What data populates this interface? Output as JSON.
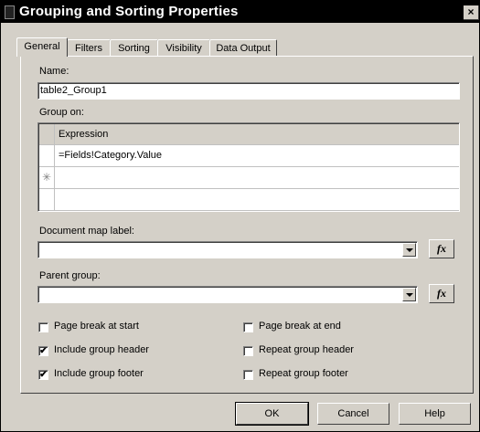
{
  "window": {
    "title": "Grouping and Sorting Properties",
    "close_glyph": "×"
  },
  "tabs": [
    {
      "label": "General"
    },
    {
      "label": "Filters"
    },
    {
      "label": "Sorting"
    },
    {
      "label": "Visibility"
    },
    {
      "label": "Data Output"
    }
  ],
  "general": {
    "name_label": "Name:",
    "name_value": "table2_Group1",
    "group_on_label": "Group on:",
    "grid_header": "Expression",
    "grid_rows": [
      "=Fields!Category.Value"
    ],
    "new_row_glyph": "✳",
    "doc_map_label": "Document map label:",
    "doc_map_value": "",
    "parent_group_label": "Parent group:",
    "parent_group_value": "",
    "fx_label": "fx",
    "checkboxes": {
      "page_break_start": {
        "label": "Page break at start",
        "checked": false
      },
      "include_group_header": {
        "label": "Include group header",
        "checked": true
      },
      "include_group_footer": {
        "label": "Include group footer",
        "checked": true
      },
      "page_break_end": {
        "label": "Page break at end",
        "checked": false
      },
      "repeat_group_header": {
        "label": "Repeat group header",
        "checked": false
      },
      "repeat_group_footer": {
        "label": "Repeat group footer",
        "checked": false
      }
    }
  },
  "buttons": {
    "ok": "OK",
    "cancel": "Cancel",
    "help": "Help"
  }
}
